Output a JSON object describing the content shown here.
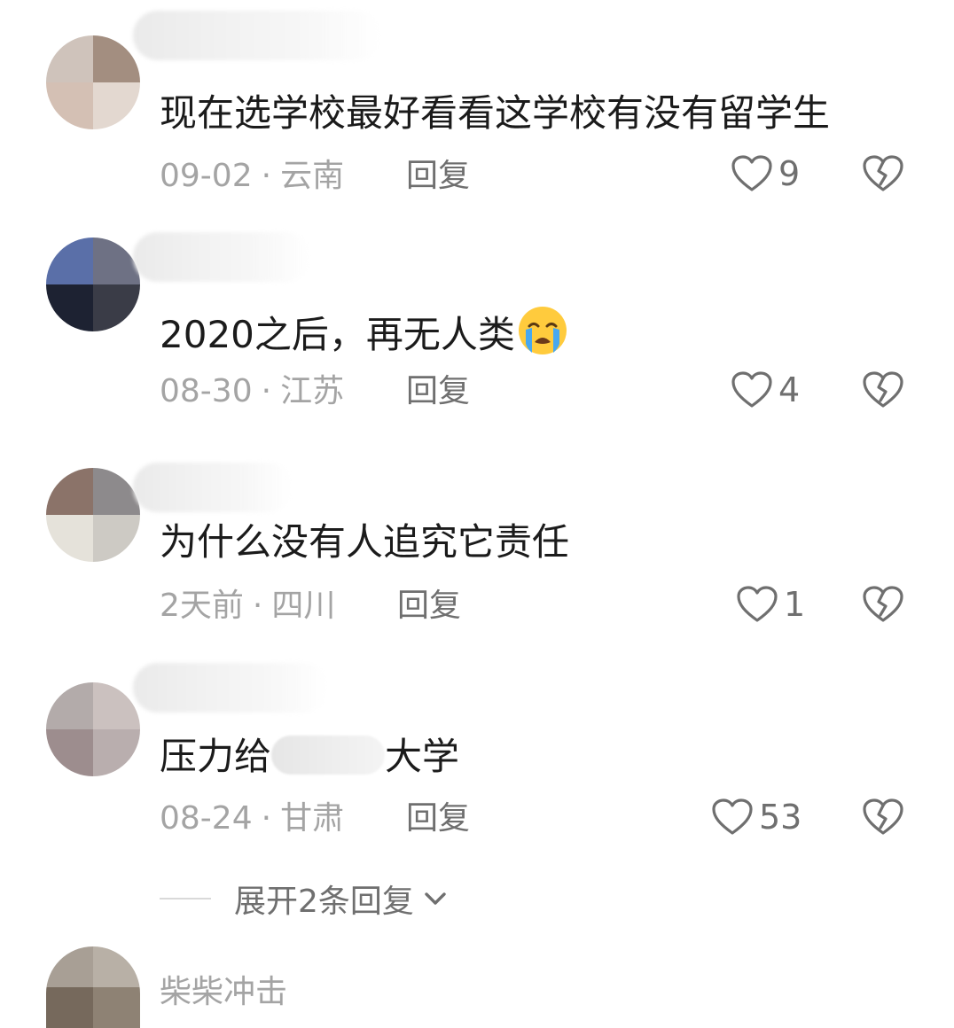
{
  "comments": [
    {
      "name_visible": "",
      "text": "现在选学校最好看看这学校有没有留学生",
      "date": "09-02",
      "location": "云南",
      "reply_label": "回复",
      "likes": "9"
    },
    {
      "name_visible": "",
      "text": "2020之后，再无人类",
      "emoji": "loudly-crying-face",
      "date": "08-30",
      "location": "江苏",
      "reply_label": "回复",
      "likes": "4"
    },
    {
      "name_visible": "",
      "text": "为什么没有人追究它责任",
      "date": "2天前",
      "location": "四川",
      "reply_label": "回复",
      "likes": "1"
    },
    {
      "name_visible": "",
      "text_before": "压力给",
      "text_after": "大学",
      "date": "08-24",
      "location": "甘肃",
      "reply_label": "回复",
      "likes": "53"
    }
  ],
  "expand_replies": {
    "label": "展开2条回复",
    "icon": "chevron-down-icon"
  },
  "last_comment": {
    "username": "柴柴冲击"
  },
  "separator": "·",
  "icons": {
    "like": "heart-outline-icon",
    "dislike": "broken-heart-icon"
  },
  "colors": {
    "text": "#1b1b1b",
    "meta": "#a4a4a4",
    "action": "#6f6f6f"
  }
}
